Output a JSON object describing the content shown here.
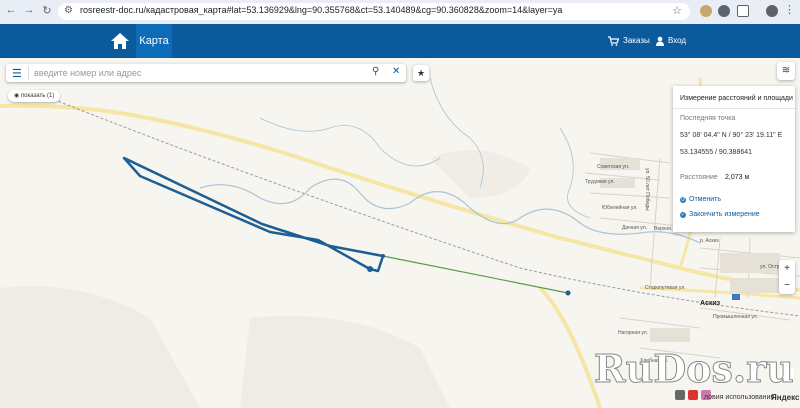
{
  "browser": {
    "url": "rosreestr-doc.ru/кадастровая_карта#lat=53.136929&lng=90.355768&ct=53.140489&cg=90.360828&zoom=14&layer=ya"
  },
  "header": {
    "tab_map": "Карта",
    "orders": "Заказы",
    "login": "Вход",
    "brand_color": "#0a5a9c"
  },
  "search": {
    "placeholder": "введите номер или адрес"
  },
  "show_button": "показать (1)",
  "measure_panel": {
    "title": "Измерение расстояний и площади",
    "last_point_label": "Последняя точка",
    "dms": "53° 08' 04.4\" N / 90° 23' 19.11\" E",
    "decimal": "53.134555 / 90.388641",
    "distance_label": "Расстояние",
    "distance_value": "2,073 м",
    "cancel": "Отменить",
    "finish": "Закончить измерение"
  },
  "zoom": {
    "in": "+",
    "out": "−"
  },
  "map_labels": {
    "town": "Аскиз",
    "streets": [
      "Советская ул.",
      "Трудовая ул.",
      "Юбилейная ул.",
      "Дачная ул.",
      "ул. 50 лет Победы",
      "Старопутевая ул.",
      "Промышленная ул.",
      "Нагорная ул.",
      "Хлебная ул.",
      "ул. Остр..",
      "р. Аскиз",
      "Верхня.."
    ]
  },
  "footer": {
    "terms": "ловия использования",
    "yandex": "Яндекс"
  },
  "watermark": "RuDos.ru"
}
